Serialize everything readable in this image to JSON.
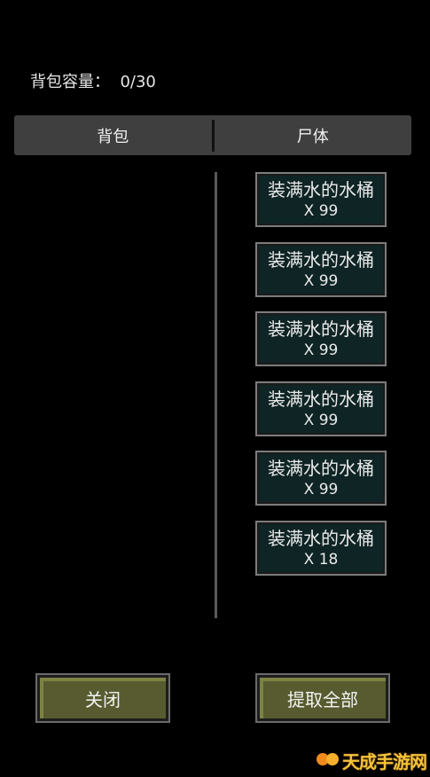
{
  "capacity": {
    "label": "背包容量：  0/30"
  },
  "tabs": [
    {
      "label": "背包"
    },
    {
      "label": "尸体"
    }
  ],
  "corpse_items": [
    {
      "name": "装满水的水桶",
      "count": "X 99"
    },
    {
      "name": "装满水的水桶",
      "count": "X 99"
    },
    {
      "name": "装满水的水桶",
      "count": "X 99"
    },
    {
      "name": "装满水的水桶",
      "count": "X 99"
    },
    {
      "name": "装满水的水桶",
      "count": "X 99"
    },
    {
      "name": "装满水的水桶",
      "count": "X 18"
    }
  ],
  "buttons": {
    "close": "关闭",
    "take_all": "提取全部"
  },
  "watermark": {
    "text": "天成手游网"
  },
  "colors": {
    "background": "#000000",
    "tab_bar": "#3f3f3f",
    "item_bg": "#0f2424",
    "button_bg": "#575b2f",
    "watermark": "#f3c23b"
  }
}
